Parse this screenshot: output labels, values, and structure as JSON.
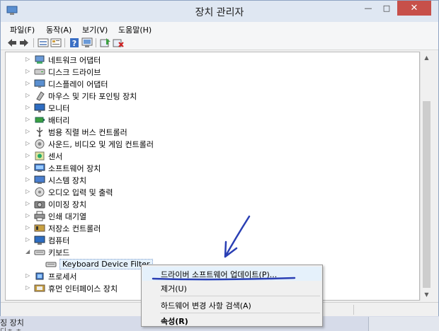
{
  "window": {
    "title": "장치 관리자",
    "controls": {
      "minimize": "—",
      "maximize": "□",
      "close": "✕"
    }
  },
  "menubar": {
    "items": [
      "파일(F)",
      "동작(A)",
      "보기(V)",
      "도움말(H)"
    ]
  },
  "toolbar": {
    "icons": [
      "back-arrow-icon",
      "forward-arrow-icon",
      "view-icon",
      "properties-icon",
      "help-icon",
      "monitor-icon",
      "update-driver-icon",
      "uninstall-icon"
    ]
  },
  "tree": {
    "items": [
      {
        "label": "네트워크 어댑터",
        "icon": "network-adapter-icon",
        "expander": "▷"
      },
      {
        "label": "디스크 드라이브",
        "icon": "disk-drive-icon",
        "expander": "▷"
      },
      {
        "label": "디스플레이 어댑터",
        "icon": "display-adapter-icon",
        "expander": "▷"
      },
      {
        "label": "마우스 및 기타 포인팅 장치",
        "icon": "mouse-icon",
        "expander": "▷"
      },
      {
        "label": "모니터",
        "icon": "monitor-icon",
        "expander": "▷"
      },
      {
        "label": "배터리",
        "icon": "battery-icon",
        "expander": "▷"
      },
      {
        "label": "범용 직렬 버스 컨트롤러",
        "icon": "usb-icon",
        "expander": "▷"
      },
      {
        "label": "사운드, 비디오 및 게임 컨트롤러",
        "icon": "sound-icon",
        "expander": "▷"
      },
      {
        "label": "센서",
        "icon": "sensor-icon",
        "expander": "▷"
      },
      {
        "label": "소프트웨어 장치",
        "icon": "software-device-icon",
        "expander": "▷"
      },
      {
        "label": "시스템 장치",
        "icon": "system-device-icon",
        "expander": "▷"
      },
      {
        "label": "오디오 입력 및 출력",
        "icon": "audio-icon",
        "expander": "▷"
      },
      {
        "label": "이미징 장치",
        "icon": "camera-icon",
        "expander": "▷"
      },
      {
        "label": "인쇄 대기열",
        "icon": "printer-icon",
        "expander": "▷"
      },
      {
        "label": "저장소 컨트롤러",
        "icon": "storage-controller-icon",
        "expander": "▷"
      },
      {
        "label": "컴퓨터",
        "icon": "computer-icon",
        "expander": "▷"
      },
      {
        "label": "키보드",
        "icon": "keyboard-icon",
        "expander": "◢"
      },
      {
        "label": "Keyboard Device Filter",
        "icon": "keyboard-icon",
        "expander": ""
      },
      {
        "label": "프로세서",
        "icon": "processor-icon",
        "expander": "▷"
      },
      {
        "label": "휴먼 인터페이스 장치",
        "icon": "hid-icon",
        "expander": "▷"
      }
    ]
  },
  "context_menu": {
    "items": [
      {
        "label": "드라이버 소프트웨어 업데이트(P)...",
        "bold": false
      },
      {
        "label": "제거(U)",
        "bold": false
      },
      {
        "label": "하드웨어 변경 사항 검색(A)",
        "bold": false
      },
      {
        "label": "속성(R)",
        "bold": true
      }
    ]
  },
  "background": {
    "partial_text": "징 장치",
    "partial_text_2": "디ㅎ ㅎ"
  },
  "colors": {
    "annotation": "#2a3fb4",
    "close_button": "#c7504a",
    "selection": "#e5f1fb"
  }
}
